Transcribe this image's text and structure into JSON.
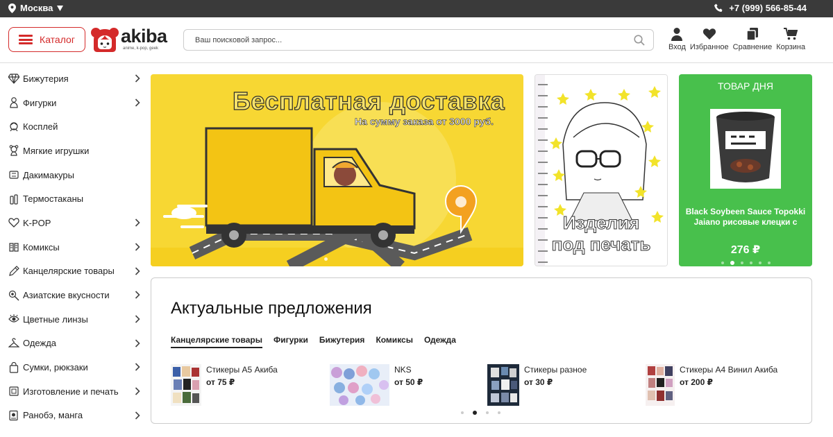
{
  "topbar": {
    "city": "Москва",
    "phone": "+7 (999) 566-85-44"
  },
  "header": {
    "catalog_label": "Каталог",
    "logo_word": "akiba",
    "logo_tagline": "anime, k-pop, geek",
    "search_placeholder": "Ваш поисковой запрос...",
    "actions": [
      {
        "label": "Вход",
        "icon": "user-icon"
      },
      {
        "label": "Избранное",
        "icon": "heart-icon"
      },
      {
        "label": "Сравнение",
        "icon": "compare-icon"
      },
      {
        "label": "Корзина",
        "icon": "cart-icon"
      }
    ]
  },
  "sidebar": {
    "items": [
      {
        "label": "Бижутерия",
        "icon": "diamond-icon",
        "has_sub": true
      },
      {
        "label": "Фигурки",
        "icon": "figure-icon",
        "has_sub": true
      },
      {
        "label": "Косплей",
        "icon": "cosplay-icon",
        "has_sub": false
      },
      {
        "label": "Мягкие игрушки",
        "icon": "plush-icon",
        "has_sub": false
      },
      {
        "label": "Дакимакуры",
        "icon": "pillow-icon",
        "has_sub": false
      },
      {
        "label": "Термостаканы",
        "icon": "bottle-icon",
        "has_sub": false
      },
      {
        "label": "K-POP",
        "icon": "heart-outline-icon",
        "has_sub": true
      },
      {
        "label": "Комиксы",
        "icon": "book-icon",
        "has_sub": true
      },
      {
        "label": "Канцелярские товары",
        "icon": "pencil-icon",
        "has_sub": true
      },
      {
        "label": "Азиатские вкусности",
        "icon": "food-icon",
        "has_sub": true
      },
      {
        "label": "Цветные линзы",
        "icon": "eye-icon",
        "has_sub": true
      },
      {
        "label": "Одежда",
        "icon": "hanger-icon",
        "has_sub": true
      },
      {
        "label": "Сумки, рюкзаки",
        "icon": "bag-icon",
        "has_sub": true
      },
      {
        "label": "Изготовление и печать",
        "icon": "printer-icon",
        "has_sub": true
      },
      {
        "label": "Ранобэ, манга",
        "icon": "manga-icon",
        "has_sub": true
      }
    ]
  },
  "banners": {
    "main": {
      "title": "Бесплатная доставка",
      "subtitle": "На сумму заказа от 3000 руб."
    },
    "print": {
      "title_line1": "Изделия",
      "title_line2": "под печать"
    }
  },
  "deal": {
    "title": "ТОВАР ДНЯ",
    "name": "Black Soybeen Sauce Topokki Jaiano рисовые клецки с",
    "price": "276 ₽"
  },
  "offers": {
    "title": "Актуальные предложения",
    "tabs": [
      "Канцелярские товары",
      "Фигурки",
      "Бижутерия",
      "Комиксы",
      "Одежда"
    ],
    "products": [
      {
        "name": "Стикеры А5 Акиба",
        "price": "от 75 ₽"
      },
      {
        "name": "NKS",
        "price": "от 50 ₽"
      },
      {
        "name": "Стикеры разное",
        "price": "от 30 ₽"
      },
      {
        "name": "Стикеры А4 Винил Акиба",
        "price": "от 200 ₽"
      }
    ]
  },
  "colors": {
    "accent": "#d42a2a",
    "topbar": "#3a3a3a",
    "deal_green": "#48c04c",
    "banner_yellow": "#f7d733"
  }
}
